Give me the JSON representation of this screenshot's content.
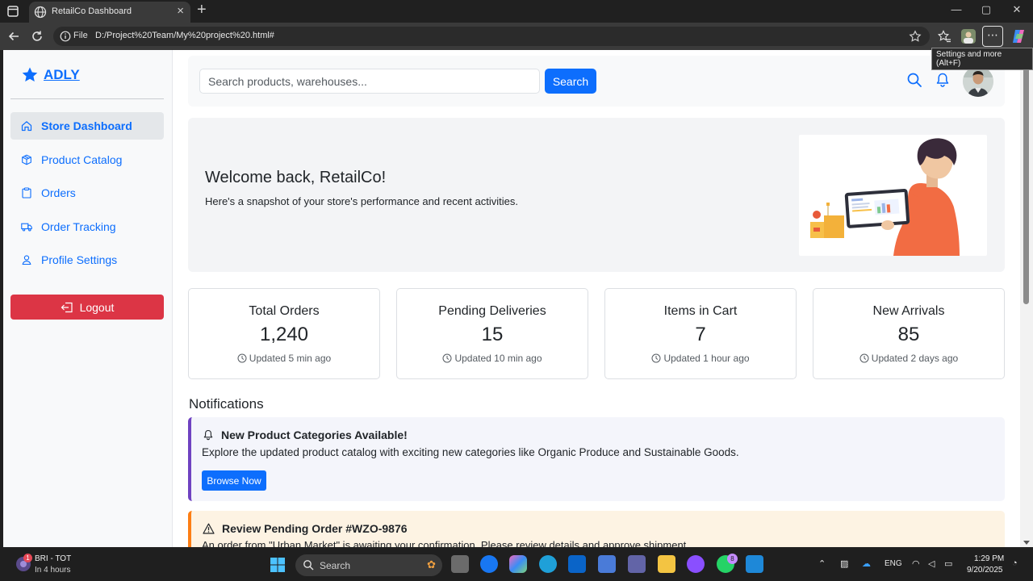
{
  "browser": {
    "tab_title": "RetailCo Dashboard",
    "url_protocol": "File",
    "url": "D:/Project%20Team/My%20project%20.html#",
    "tooltip": "Settings and more (Alt+F)"
  },
  "brand": {
    "name": "ADLY",
    "color": "#0d6efd"
  },
  "sidebar": {
    "items": [
      {
        "label": "Store Dashboard",
        "icon": "home-icon",
        "active": true
      },
      {
        "label": "Product Catalog",
        "icon": "box-icon"
      },
      {
        "label": "Orders",
        "icon": "clipboard-icon"
      },
      {
        "label": "Order Tracking",
        "icon": "truck-icon"
      },
      {
        "label": "Profile Settings",
        "icon": "person-icon"
      }
    ],
    "logout_label": "Logout"
  },
  "search": {
    "placeholder": "Search products, warehouses...",
    "button_label": "Search"
  },
  "hero": {
    "title": "Welcome back, RetailCo!",
    "subtitle": "Here's a snapshot of your store's performance and recent activities."
  },
  "stats": [
    {
      "label": "Total Orders",
      "value": "1,240",
      "updated": "Updated 5 min ago"
    },
    {
      "label": "Pending Deliveries",
      "value": "15",
      "updated": "Updated 10 min ago"
    },
    {
      "label": "Items in Cart",
      "value": "7",
      "updated": "Updated 1 hour ago"
    },
    {
      "label": "New Arrivals",
      "value": "85",
      "updated": "Updated 2 days ago"
    }
  ],
  "notifications": {
    "title": "Notifications",
    "items": [
      {
        "title": "New Product Categories Available!",
        "body": "Explore the updated product catalog with exciting new categories like Organic Produce and Sustainable Goods.",
        "button_label": "Browse Now",
        "accent": "#6f42c1"
      },
      {
        "title": "Review Pending Order #WZO-9876",
        "body": "An order from \"Urban Market\" is awaiting your confirmation. Please review details and approve shipment.",
        "accent": "#fd7e14"
      }
    ]
  },
  "taskbar": {
    "weather_title": "BRI - TOT",
    "weather_sub": "In 4 hours",
    "weather_badge": "1",
    "search_label": "Search",
    "app_badge": "8",
    "language": "ENG",
    "time": "1:29 PM",
    "date": "9/20/2025"
  },
  "colors": {
    "primary": "#0d6efd",
    "danger": "#dc3545"
  }
}
